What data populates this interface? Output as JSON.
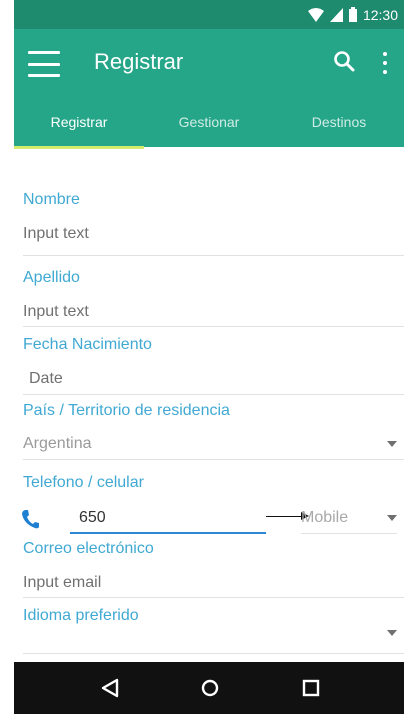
{
  "status_bar": {
    "time": "12:30"
  },
  "app_bar": {
    "title": "Registrar"
  },
  "tabs": [
    {
      "label": "Registrar",
      "active": true
    },
    {
      "label": "Gestionar",
      "active": false
    },
    {
      "label": "Destinos",
      "active": false
    }
  ],
  "form": {
    "nombre": {
      "label": "Nombre",
      "placeholder": "Input text"
    },
    "apellido": {
      "label": "Apellido",
      "placeholder": "Input text"
    },
    "fecha_nacimiento": {
      "label": "Fecha Nacimiento",
      "placeholder": "Date"
    },
    "pais": {
      "label": "País / Territorio de residencia",
      "value": "Argentina"
    },
    "telefono": {
      "label": "Telefono / celular",
      "value": "650",
      "type_value": "Mobile"
    },
    "correo": {
      "label": "Correo electrónico",
      "placeholder": "Input email"
    },
    "idioma": {
      "label": "Idioma preferido",
      "value": ""
    }
  },
  "colors": {
    "status_bar": "#1e8a6e",
    "app_bar": "#26a689",
    "tab_indicator": "#d4ec6e",
    "label": "#3fa9d3",
    "input_focus": "#2b86d6"
  },
  "icons": [
    "wifi-icon",
    "signal-icon",
    "battery-icon",
    "menu-icon",
    "search-icon",
    "more-vert-icon",
    "phone-icon",
    "dropdown-arrow-icon",
    "back-icon",
    "home-icon",
    "recents-icon"
  ]
}
